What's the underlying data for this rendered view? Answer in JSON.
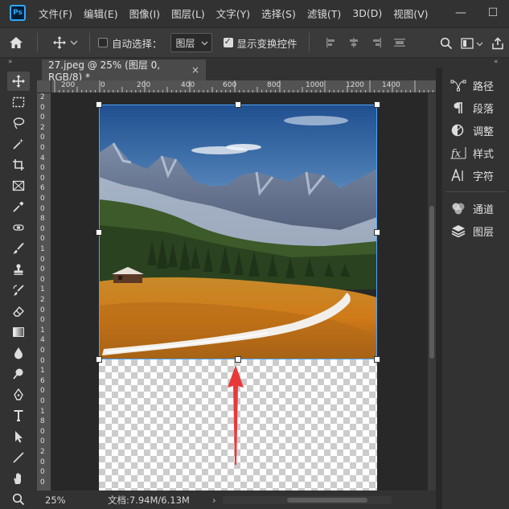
{
  "app": {
    "logo_text": "Ps",
    "accent": "#31a8ff"
  },
  "menu": [
    {
      "label": "文件(F)"
    },
    {
      "label": "编辑(E)"
    },
    {
      "label": "图像(I)"
    },
    {
      "label": "图层(L)"
    },
    {
      "label": "文字(Y)"
    },
    {
      "label": "选择(S)"
    },
    {
      "label": "滤镜(T)"
    },
    {
      "label": "3D(D)"
    },
    {
      "label": "视图(V)"
    }
  ],
  "window_controls": {
    "minimize": "—",
    "maximize": "☐",
    "close": "✕"
  },
  "options_bar": {
    "auto_select_label": "自动选择：",
    "auto_select_checked": false,
    "layer_dropdown": "图层",
    "show_transform_label": "显示变换控件",
    "show_transform_checked": true
  },
  "document": {
    "tab_title": "27.jpeg @ 25% (图层 0, RGB/8) *",
    "close": "×",
    "ruler_h": [
      "200",
      "0",
      "200",
      "400",
      "600",
      "800",
      "1000",
      "1200",
      "1400"
    ],
    "ruler_v": [
      "2",
      "0",
      "0",
      "2",
      "0",
      "0",
      "4",
      "0",
      "0",
      "6",
      "0",
      "0",
      "8",
      "0",
      "0",
      "1",
      "0",
      "0",
      "0",
      "1",
      "2",
      "0",
      "0",
      "1",
      "4",
      "0",
      "0",
      "1",
      "6",
      "0",
      "0",
      "1",
      "8",
      "0",
      "0",
      "2",
      "0",
      "0",
      "0"
    ]
  },
  "right_panels": [
    {
      "label": "路径",
      "icon": "paths-icon"
    },
    {
      "label": "段落",
      "icon": "paragraph-icon"
    },
    {
      "label": "调整",
      "icon": "adjustments-icon"
    },
    {
      "label": "样式",
      "icon": "styles-icon"
    },
    {
      "label": "字符",
      "icon": "character-icon"
    },
    {
      "label": "通道",
      "icon": "channels-icon"
    },
    {
      "label": "图层",
      "icon": "layers-icon"
    }
  ],
  "status": {
    "zoom": "25%",
    "doc_size": "文档:7.94M/6.13M",
    "arrow": "›"
  },
  "panel_collapse": "»",
  "panel_expand": "«",
  "annotation_color": "#e8393a"
}
